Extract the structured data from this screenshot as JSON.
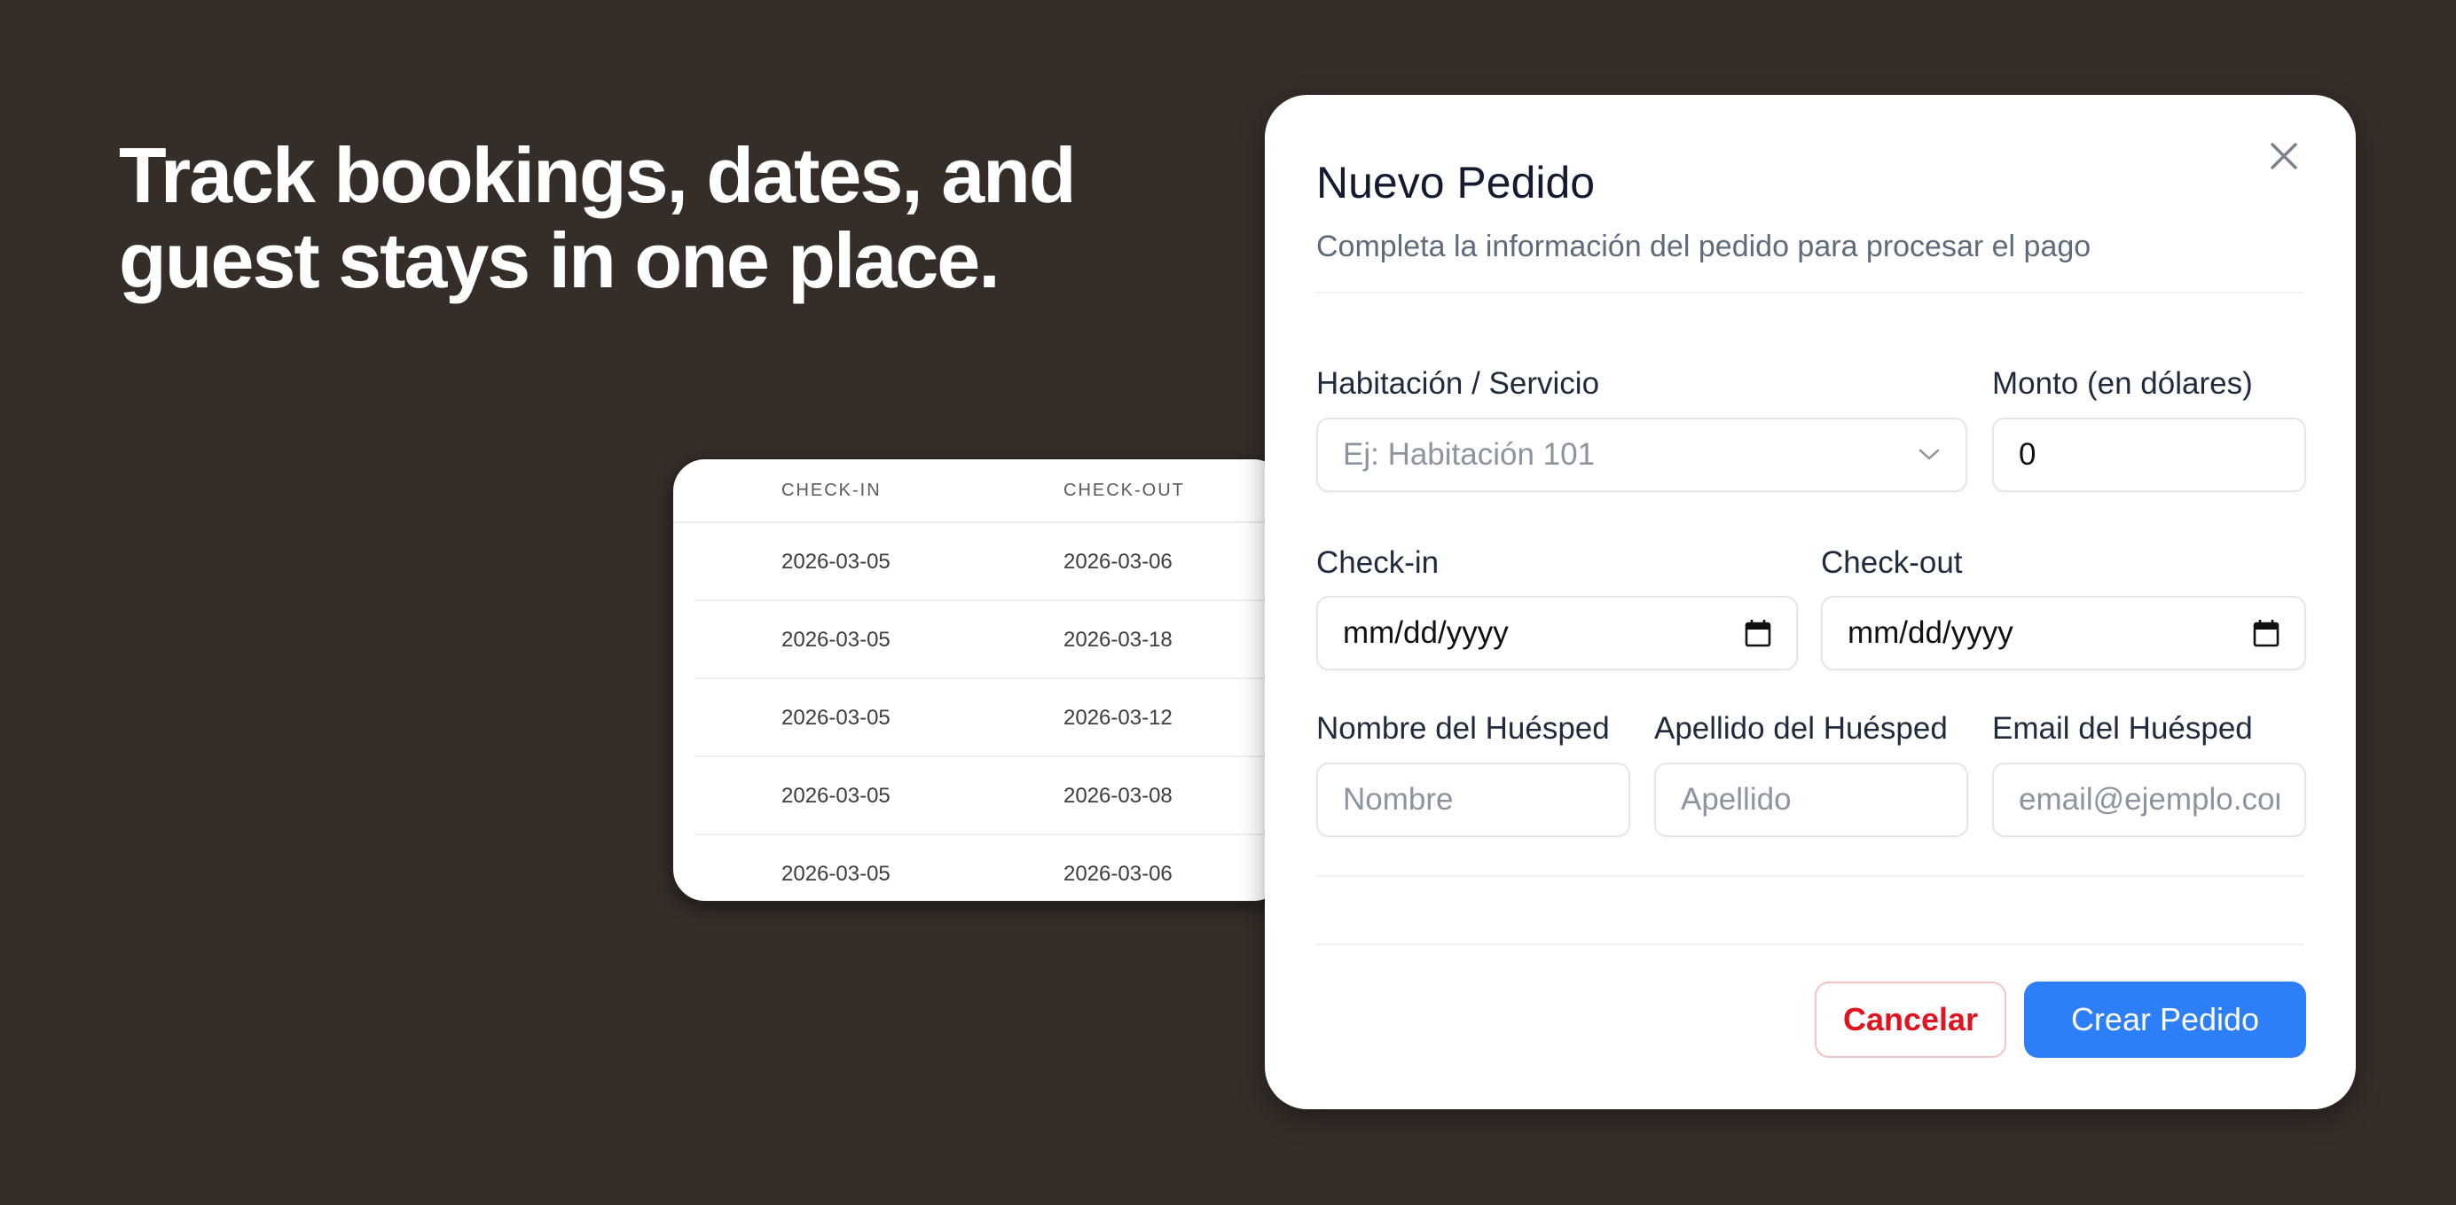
{
  "headline": {
    "line1": "Track bookings, dates, and",
    "line2": "guest stays in one place."
  },
  "bookings_table": {
    "columns": [
      "CHECK-IN",
      "CHECK-OUT"
    ],
    "rows": [
      {
        "check_in": "2026-03-05",
        "check_out": "2026-03-06"
      },
      {
        "check_in": "2026-03-05",
        "check_out": "2026-03-18"
      },
      {
        "check_in": "2026-03-05",
        "check_out": "2026-03-12"
      },
      {
        "check_in": "2026-03-05",
        "check_out": "2026-03-08"
      },
      {
        "check_in": "2026-03-05",
        "check_out": "2026-03-06"
      }
    ]
  },
  "modal": {
    "title": "Nuevo Pedido",
    "description": "Completa la información del pedido para procesar el pago",
    "close_icon": "close-icon",
    "fields": {
      "room": {
        "label": "Habitación / Servicio",
        "placeholder": "Ej: Habitación 101"
      },
      "amount": {
        "label": "Monto (en dólares)",
        "value": "0"
      },
      "checkin": {
        "label": "Check-in",
        "placeholder": "mm/dd/yyyy"
      },
      "checkout": {
        "label": "Check-out",
        "placeholder": "mm/dd/yyyy"
      },
      "first_name": {
        "label": "Nombre del Huésped",
        "placeholder": "Nombre"
      },
      "last_name": {
        "label": "Apellido del Huésped",
        "placeholder": "Apellido"
      },
      "email": {
        "label": "Email del Huésped",
        "placeholder": "email@ejemplo.com"
      }
    },
    "buttons": {
      "cancel": "Cancelar",
      "create": "Crear Pedido"
    }
  },
  "colors": {
    "background": "#352d28",
    "accent": "#2d7ff9",
    "danger": "#e0141e"
  }
}
